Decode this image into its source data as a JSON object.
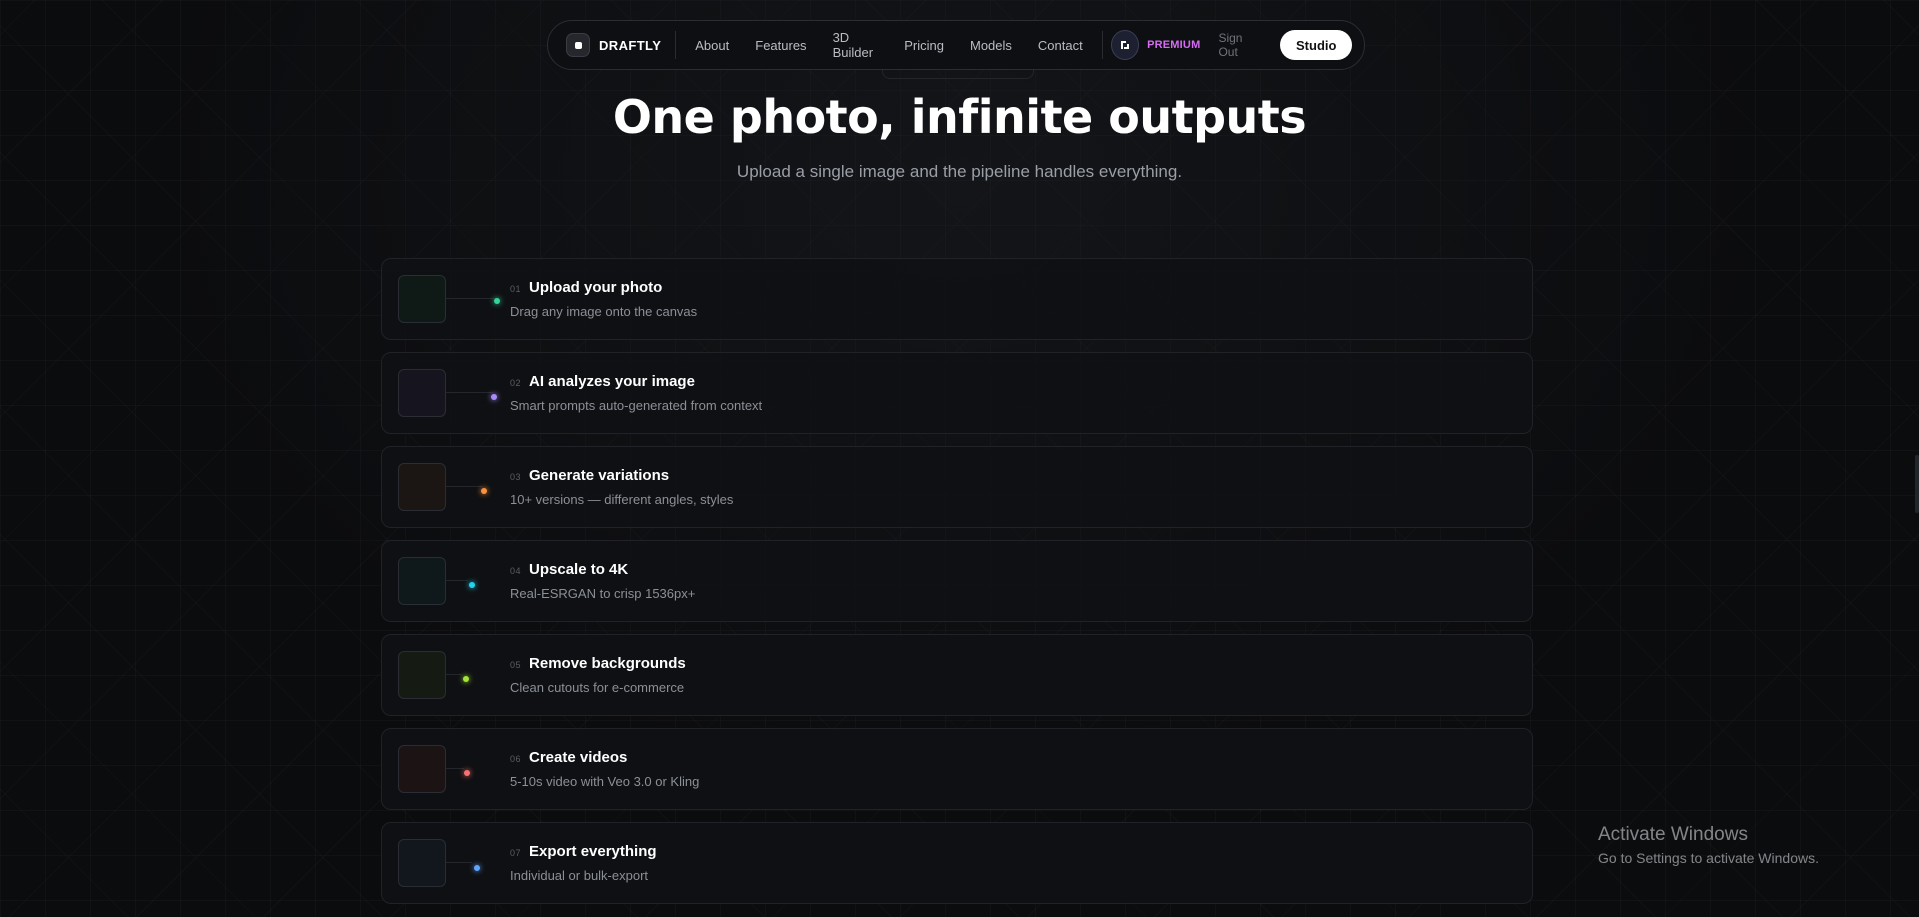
{
  "nav": {
    "brand": "DRAFTLY",
    "links": [
      "About",
      "Features",
      "3D Builder",
      "Pricing",
      "Models",
      "Contact"
    ],
    "premium": "PREMIUM",
    "signout": "Sign Out",
    "studio": "Studio"
  },
  "hero": {
    "title": "One photo, infinite outputs",
    "subtitle": "Upload a single image and the pipeline handles everything."
  },
  "steps": [
    {
      "num": "01",
      "title": "Upload your photo",
      "desc": "Drag any image onto the canvas",
      "color": "#34d399",
      "thumb": "#0f1a17"
    },
    {
      "num": "02",
      "title": "AI analyzes your image",
      "desc": "Smart prompts auto-generated from context",
      "color": "#a78bfa",
      "thumb": "#15141f"
    },
    {
      "num": "03",
      "title": "Generate variations",
      "desc": "10+ versions — different angles, styles",
      "color": "#fb923c",
      "thumb": "#1b1613"
    },
    {
      "num": "04",
      "title": "Upscale to 4K",
      "desc": "Real-ESRGAN to crisp 1536px+",
      "color": "#22d3ee",
      "thumb": "#0f181b"
    },
    {
      "num": "05",
      "title": "Remove backgrounds",
      "desc": "Clean cutouts for e-commerce",
      "color": "#a3e635",
      "thumb": "#151a12"
    },
    {
      "num": "06",
      "title": "Create videos",
      "desc": "5-10s video with Veo 3.0 or Kling",
      "color": "#f87171",
      "thumb": "#1c1314"
    },
    {
      "num": "07",
      "title": "Export everything",
      "desc": "Individual or bulk-export",
      "color": "#60a5fa",
      "thumb": "#12161d"
    }
  ],
  "watermark": {
    "title": "Activate Windows",
    "subtitle": "Go to Settings to activate Windows."
  }
}
